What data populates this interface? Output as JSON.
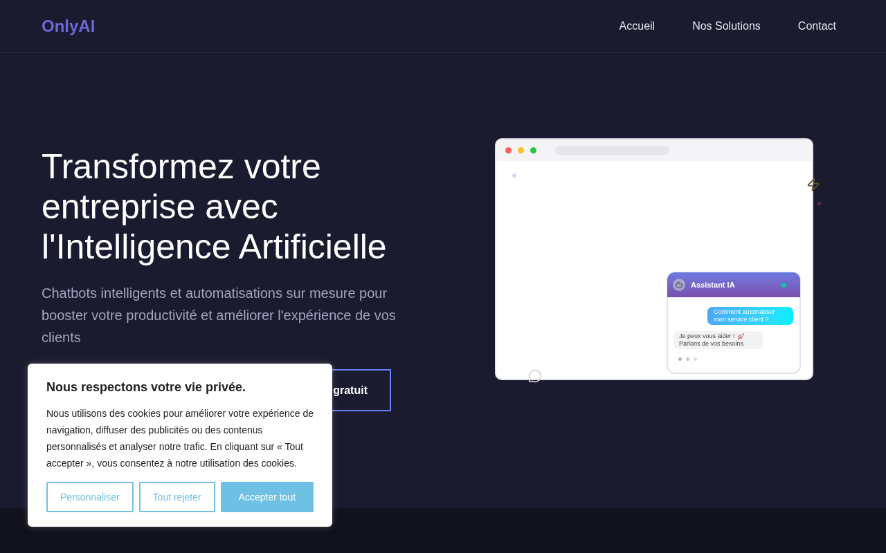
{
  "header": {
    "logo": "OnlyAI",
    "nav": [
      {
        "label": "Accueil"
      },
      {
        "label": "Nos Solutions"
      },
      {
        "label": "Contact"
      }
    ]
  },
  "hero": {
    "title": "Transformez votre entreprise avec l'Intelligence Artificielle",
    "subtitle": "Chatbots intelligents et automatisations sur mesure pour booster votre productivité et améliorer l'expérience de vos clients",
    "cta": "gratuit"
  },
  "mockup": {
    "chat": {
      "title": "Assistant IA",
      "online": true,
      "messages": [
        {
          "kind": "user",
          "text": "Comment automatiser mon service client ?"
        },
        {
          "kind": "bot",
          "text": "Je peux vous aider !",
          "text2": "Parlons de vos besoins"
        }
      ]
    }
  },
  "cookie_dialog": {
    "title": "Nous respectons votre vie privée.",
    "body": "Nous utilisons des cookies pour améliorer votre expérience de navigation, diffuser des publicités ou des contenus personnalisés et analyser notre trafic. En cliquant sur « Tout accepter », vous consentez à notre utilisation des cookies.",
    "buttons": [
      {
        "label": "Personnaliser",
        "kind": "outline"
      },
      {
        "label": "Tout rejeter",
        "kind": "outline"
      },
      {
        "label": "Accepter tout",
        "kind": "filled"
      }
    ]
  }
}
